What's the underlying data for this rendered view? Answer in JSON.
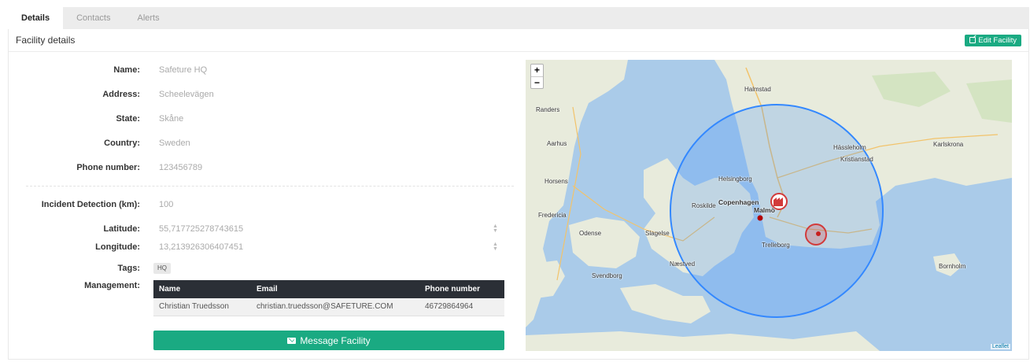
{
  "tabs": [
    {
      "label": "Details",
      "active": true
    },
    {
      "label": "Contacts",
      "active": false
    },
    {
      "label": "Alerts",
      "active": false
    }
  ],
  "header": {
    "title": "Facility details",
    "edit_label": "Edit Facility"
  },
  "facility": {
    "name_label": "Name:",
    "name": "Safeture HQ",
    "address_label": "Address:",
    "address": "Scheelevägen",
    "state_label": "State:",
    "state": "Skåne",
    "country_label": "Country:",
    "country": "Sweden",
    "phone_label": "Phone number:",
    "phone": "123456789",
    "incident_label": "Incident Detection (km):",
    "incident": "100",
    "lat_label": "Latitude:",
    "lat": "55,717725278743615",
    "lng_label": "Longitude:",
    "lng": "13,213926306407451",
    "tags_label": "Tags:",
    "tag": "HQ",
    "management_label": "Management:"
  },
  "management": {
    "columns": [
      "Name",
      "Email",
      "Phone number"
    ],
    "rows": [
      [
        "Christian Truedsson",
        "christian.truedsson@SAFETURE.COM",
        "46729864964"
      ]
    ]
  },
  "message_button": "Message Facility",
  "map": {
    "zoom_in": "+",
    "zoom_out": "−",
    "attribution": "Leaflet",
    "labels": {
      "copenhagen": "Copenhagen",
      "malmo": "Malmö",
      "helsingborg": "Helsingborg",
      "kristianstad": "Kristianstad",
      "roskilde": "Roskilde",
      "odense": "Odense",
      "aarhus": "Aarhus",
      "randers": "Randers",
      "halmstad": "Halmstad",
      "karlskrona": "Karlskrona",
      "slagelse": "Slagelse",
      "naestved": "Næstved",
      "svendborg": "Svendborg",
      "trelleborg": "Trelleborg",
      "horsens": "Horsens",
      "fredericia": "Fredericia",
      "hassleholm": "Hässleholm",
      "bornholm": "Bornholm"
    },
    "colors": {
      "water": "#a9c9e8",
      "land": "#e9ecde",
      "circle": "#3388ff",
      "marker": "#d23a3a"
    }
  }
}
